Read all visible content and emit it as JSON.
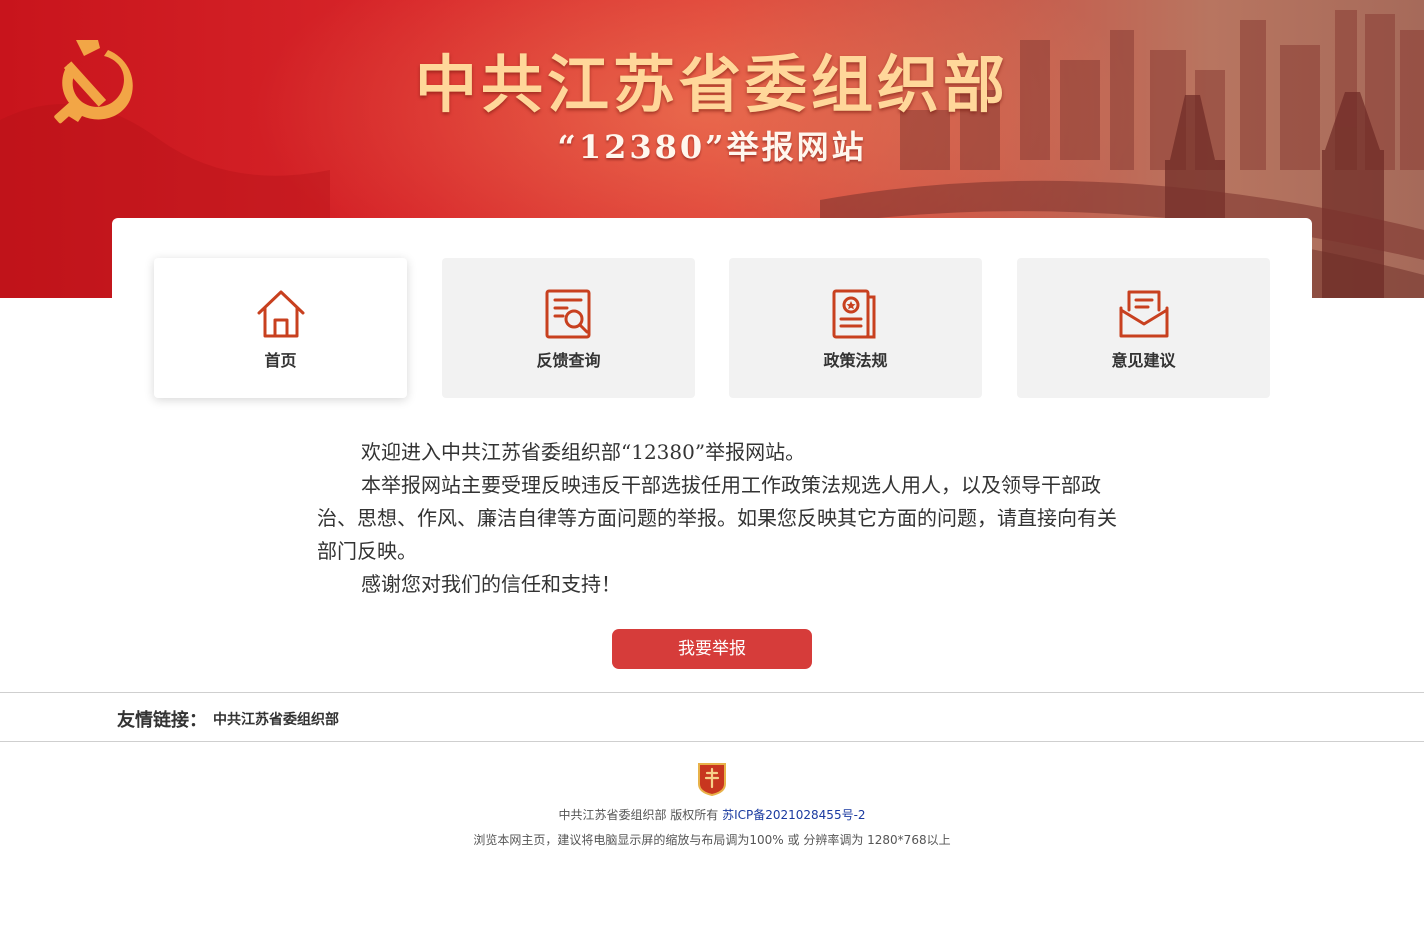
{
  "banner": {
    "title": "中共江苏省委组织部",
    "subtitle": "“12380”举报网站"
  },
  "nav": {
    "items": [
      {
        "label": "首页",
        "icon": "home-icon",
        "active": true
      },
      {
        "label": "反馈查询",
        "icon": "document-search-icon",
        "active": false
      },
      {
        "label": "政策法规",
        "icon": "policy-document-icon",
        "active": false
      },
      {
        "label": "意见建议",
        "icon": "envelope-letter-icon",
        "active": false
      }
    ]
  },
  "intro": {
    "p1": "欢迎进入中共江苏省委组织部“12380”举报网站。",
    "p2": "本举报网站主要受理反映违反干部选拔任用工作政策法规选人用人，以及领导干部政治、思想、作风、廉洁自律等方面问题的举报。如果您反映其它方面的问题，请直接向有关部门反映。",
    "p3": "感谢您对我们的信任和支持！"
  },
  "report_button": "我要举报",
  "links": {
    "title": "友情链接：",
    "items": [
      "中共江苏省委组织部"
    ]
  },
  "footer": {
    "copyright": "中共江苏省委组织部 版权所有 ",
    "icp": "苏ICP备2021028455号-2",
    "notice": "浏览本网主页，建议将电脑显示屏的缩放与布局调为100% 或 分辨率调为 1280*768以上"
  },
  "colors": {
    "brand_red": "#d63c3a",
    "icon_red": "#c8401f",
    "title_gold": "#ffd79a"
  }
}
